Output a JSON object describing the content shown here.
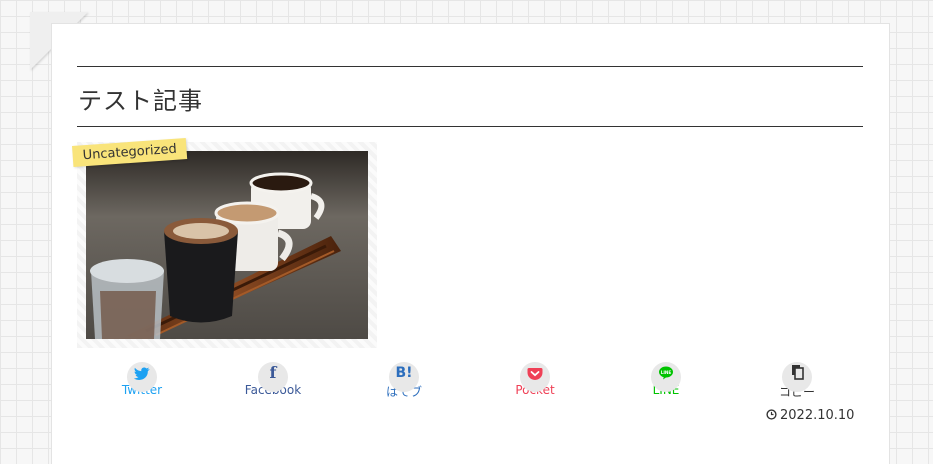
{
  "post": {
    "title": "テスト記事",
    "category": "Uncategorized",
    "date": "2022.10.10"
  },
  "share": [
    {
      "label": "Twitter",
      "icon": "twitter-icon",
      "color": "#1da1f2"
    },
    {
      "label": "Facebook",
      "icon": "facebook-icon",
      "color": "#3b5998"
    },
    {
      "label": "はてブ",
      "icon": "hatena-icon",
      "color": "#2c6ebd"
    },
    {
      "label": "Pocket",
      "icon": "pocket-icon",
      "color": "#ef4056"
    },
    {
      "label": "LINE",
      "icon": "line-icon",
      "color": "#00c300"
    },
    {
      "label": "コピー",
      "icon": "copy-icon",
      "color": "#333333"
    }
  ],
  "colors": {
    "category_bg": "#f9e47a",
    "text": "#333333"
  }
}
